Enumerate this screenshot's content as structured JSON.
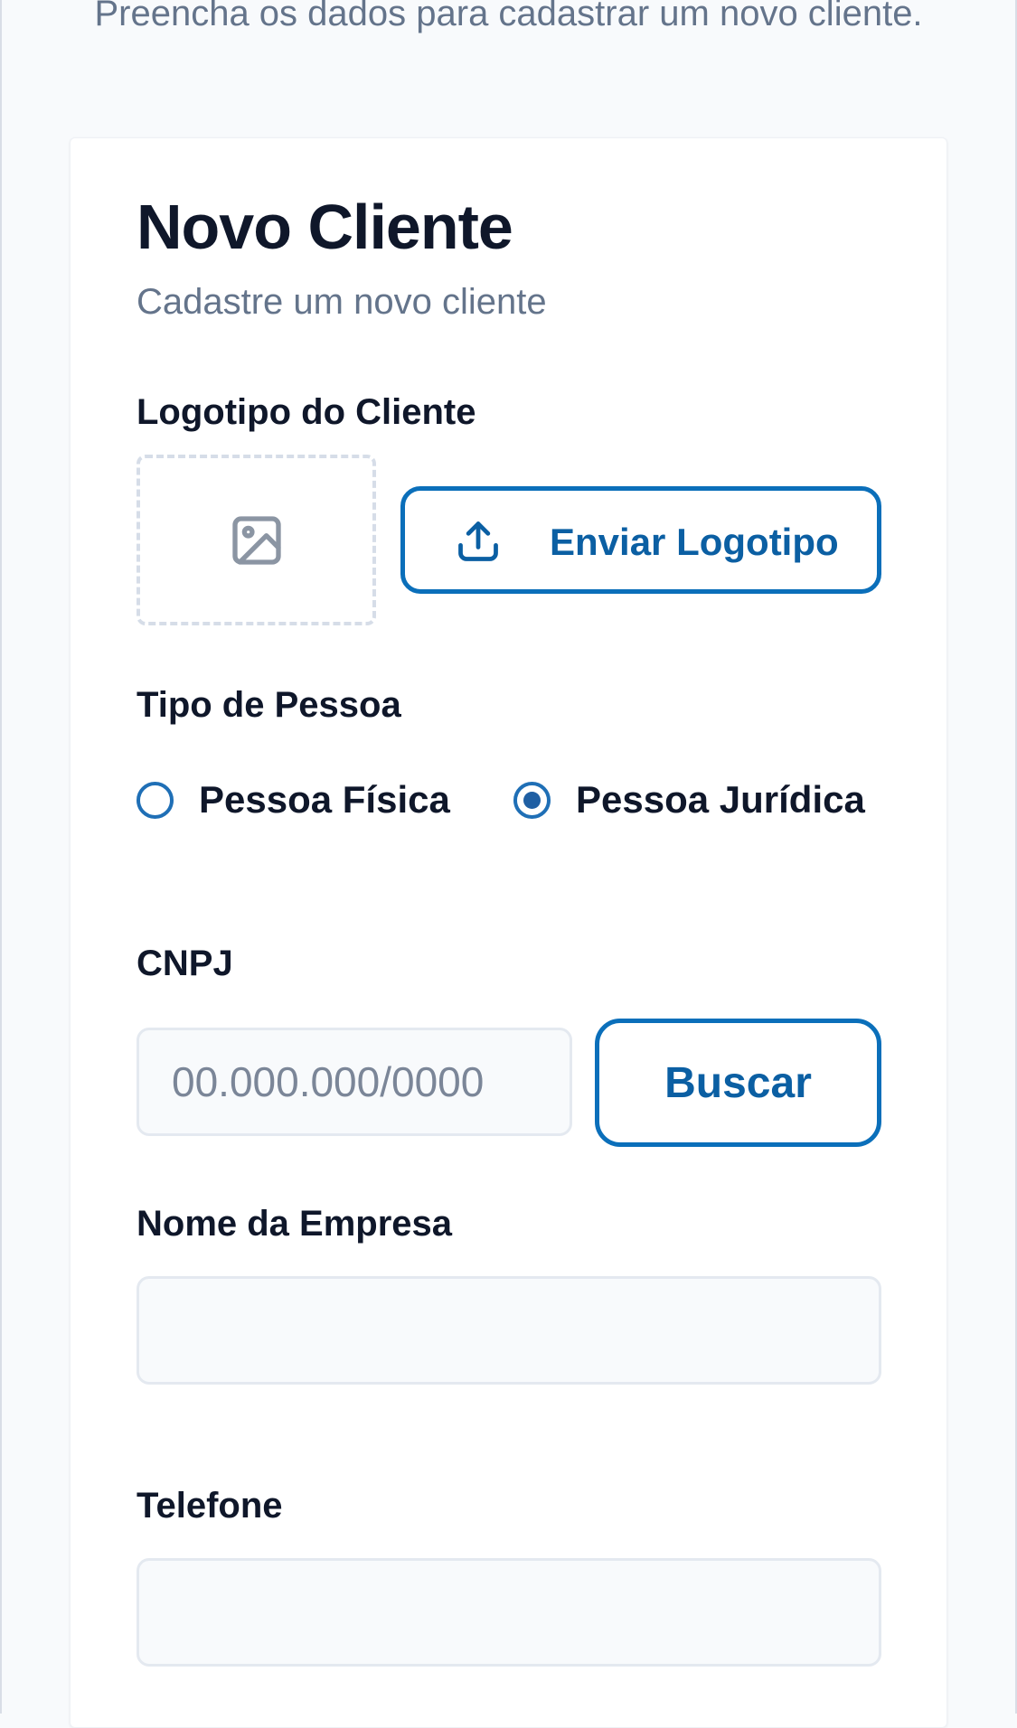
{
  "header": {
    "subtitle": "Preencha os dados para cadastrar um novo cliente."
  },
  "form": {
    "title": "Novo Cliente",
    "subtitle": "Cadastre um novo cliente",
    "logo": {
      "label": "Logotipo do Cliente",
      "upload_button": "Enviar Logotipo",
      "placeholder_icon": "image-icon",
      "upload_icon": "upload-icon"
    },
    "person_type": {
      "label": "Tipo de Pessoa",
      "options": [
        {
          "label": "Pessoa Física",
          "checked": false
        },
        {
          "label": "Pessoa Jurídica",
          "checked": true
        }
      ]
    },
    "cnpj": {
      "label": "CNPJ",
      "value": "",
      "placeholder": "00.000.000/0000",
      "search_button": "Buscar"
    },
    "company_name": {
      "label": "Nome da Empresa",
      "value": ""
    },
    "phone": {
      "label": "Telefone",
      "value": ""
    }
  },
  "colors": {
    "accent": "#0b6fba",
    "accent_text": "#0b5fa3",
    "muted_text": "#64748b",
    "input_border": "#e4e9f0"
  }
}
